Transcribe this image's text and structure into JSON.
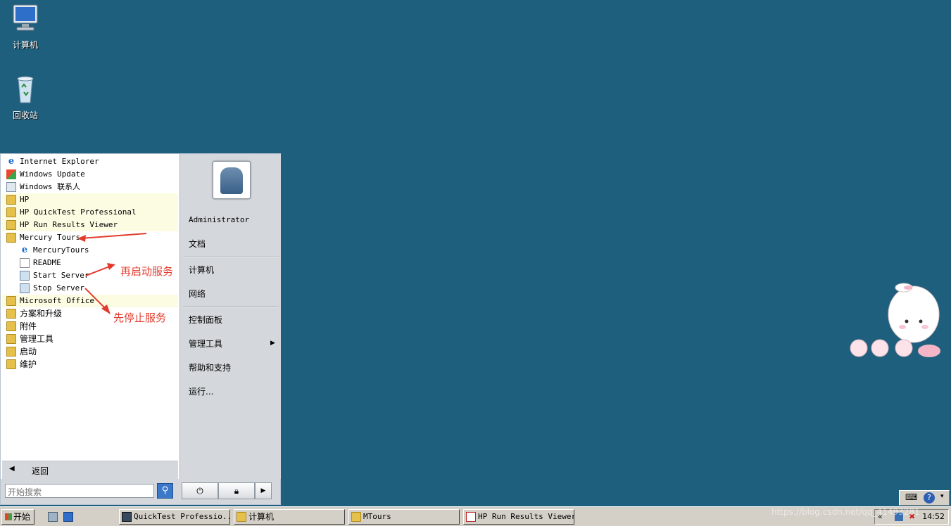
{
  "desktop": {
    "icons": [
      {
        "label": "计算机",
        "icon": "computer-icon"
      },
      {
        "label": "回收站",
        "icon": "recycle-bin-icon"
      }
    ]
  },
  "start_menu": {
    "programs": [
      {
        "label": "Internet Explorer",
        "icon": "internet-explorer-icon"
      },
      {
        "label": "Windows Update",
        "icon": "windows-update-icon"
      },
      {
        "label": "Windows 联系人",
        "icon": "contacts-icon"
      },
      {
        "label": "HP",
        "icon": "folder-icon"
      },
      {
        "label": "HP QuickTest Professional",
        "icon": "folder-icon"
      },
      {
        "label": "HP Run Results Viewer",
        "icon": "folder-icon"
      },
      {
        "label": "Mercury Tours",
        "icon": "folder-icon"
      },
      {
        "label": "MercuryTours",
        "icon": "internet-explorer-icon"
      },
      {
        "label": "README",
        "icon": "document-icon"
      },
      {
        "label": "Start Server",
        "icon": "gear-icon"
      },
      {
        "label": "Stop Server",
        "icon": "gear-icon"
      },
      {
        "label": "Microsoft Office",
        "icon": "folder-icon"
      },
      {
        "label": "方案和升级",
        "icon": "folder-icon"
      },
      {
        "label": "附件",
        "icon": "folder-icon"
      },
      {
        "label": "管理工具",
        "icon": "folder-icon"
      },
      {
        "label": "启动",
        "icon": "folder-icon"
      },
      {
        "label": "维护",
        "icon": "folder-icon"
      }
    ],
    "back_label": "返回",
    "search_placeholder": "开始搜索",
    "right": {
      "user": "Administrator",
      "documents": "文档",
      "computer": "计算机",
      "network": "网络",
      "control_panel": "控制面板",
      "admin_tools": "管理工具",
      "help": "帮助和支持",
      "run": "运行..."
    }
  },
  "annotations": {
    "start_again": "再启动服务",
    "stop_first": "先停止服务"
  },
  "taskbar": {
    "start_label": "开始",
    "tasks": [
      {
        "label": "QuickTest Professio...",
        "icon": "qtp-icon"
      },
      {
        "label": "计算机",
        "icon": "folder-icon"
      },
      {
        "label": "MTours",
        "icon": "folder-icon"
      },
      {
        "label": "HP Run Results Viewer",
        "icon": "hp-rrv-icon"
      }
    ],
    "tray_expand": "«",
    "clock": "14:52"
  },
  "watermark": "https://blog.csdn.net/qq_41493281"
}
